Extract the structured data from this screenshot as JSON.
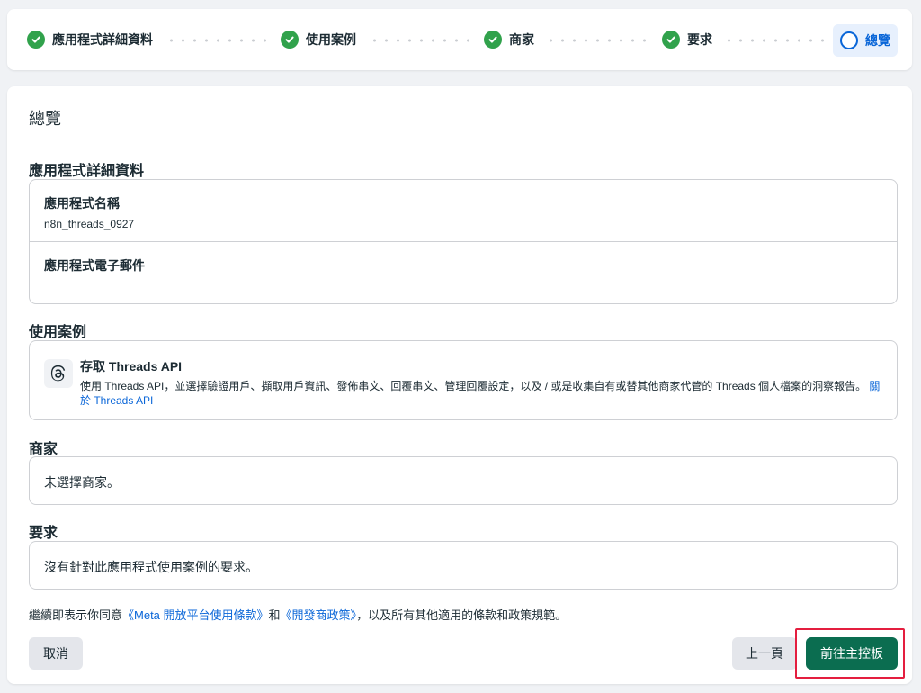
{
  "stepper": {
    "steps": [
      {
        "label": "應用程式詳細資料",
        "status": "done"
      },
      {
        "label": "使用案例",
        "status": "done"
      },
      {
        "label": "商家",
        "status": "done"
      },
      {
        "label": "要求",
        "status": "done"
      },
      {
        "label": "總覽",
        "status": "current"
      }
    ]
  },
  "overview": {
    "title": "總覽",
    "app_details": {
      "section_title": "應用程式詳細資料",
      "name_label": "應用程式名稱",
      "name_value": "n8n_threads_0927",
      "email_label": "應用程式電子郵件",
      "email_value": ""
    },
    "use_cases": {
      "section_title": "使用案例",
      "icon": "threads-logo-icon",
      "title": "存取 Threads API",
      "description": "使用 Threads API，並選擇驗證用戶、擷取用戶資訊、發佈串文、回覆串文、管理回覆設定，以及 / 或是收集自有或替其他商家代管的 Threads 個人檔案的洞察報告。",
      "link_text_1": "關",
      "link_text_2": "於 Threads API"
    },
    "business": {
      "section_title": "商家",
      "value": "未選擇商家。"
    },
    "requirements": {
      "section_title": "要求",
      "value": "沒有針對此應用程式使用案例的要求。"
    },
    "terms": {
      "prefix": "繼續即表示你同意",
      "link1": "《Meta 開放平台使用條款》",
      "middle": "和",
      "link2": "《開發商政策》",
      "suffix": "，以及所有其他適用的條款和政策規範。"
    }
  },
  "actions": {
    "cancel_label": "取消",
    "back_label": "上一頁",
    "primary_label": "前往主控板"
  },
  "colors": {
    "accent": "#0a66d8",
    "success": "#31a24c",
    "primary_button": "#0b6d50",
    "highlight": "#e41e3f"
  }
}
